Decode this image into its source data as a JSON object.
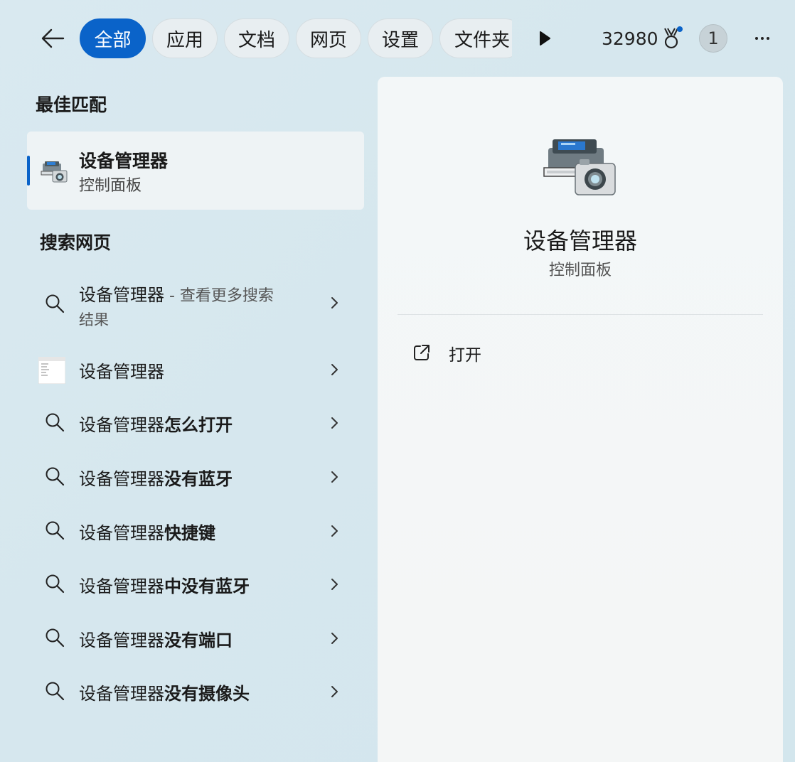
{
  "topbar": {
    "tabs": [
      {
        "label": "全部",
        "active": true
      },
      {
        "label": "应用",
        "active": false
      },
      {
        "label": "文档",
        "active": false
      },
      {
        "label": "网页",
        "active": false
      },
      {
        "label": "设置",
        "active": false
      },
      {
        "label": "文件夹",
        "active": false
      }
    ],
    "points": "32980",
    "user_badge": "1"
  },
  "best_match": {
    "section_title": "最佳匹配",
    "title": "设备管理器",
    "subtitle": "控制面板"
  },
  "web_search": {
    "section_title": "搜索网页",
    "items": [
      {
        "prefix": "设备管理器",
        "bold": "",
        "suffix": " - 查看更多搜索",
        "line2": "结果",
        "icon": "search-icon"
      },
      {
        "prefix": "设备管理器",
        "bold": "",
        "suffix": "",
        "line2": "",
        "icon": "web-thumbnail"
      },
      {
        "prefix": "设备管理器",
        "bold": "怎么打开",
        "suffix": "",
        "line2": "",
        "icon": "search-icon"
      },
      {
        "prefix": "设备管理器",
        "bold": "没有蓝牙",
        "suffix": "",
        "line2": "",
        "icon": "search-icon"
      },
      {
        "prefix": "设备管理器",
        "bold": "快捷键",
        "suffix": "",
        "line2": "",
        "icon": "search-icon"
      },
      {
        "prefix": "设备管理器",
        "bold": "中没有蓝牙",
        "suffix": "",
        "line2": "",
        "icon": "search-icon"
      },
      {
        "prefix": "设备管理器",
        "bold": "没有端口",
        "suffix": "",
        "line2": "",
        "icon": "search-icon"
      },
      {
        "prefix": "设备管理器",
        "bold": "没有摄像头",
        "suffix": "",
        "line2": "",
        "icon": "search-icon"
      }
    ]
  },
  "detail": {
    "title": "设备管理器",
    "subtitle": "控制面板",
    "actions": [
      {
        "label": "打开",
        "icon": "open-external-icon"
      }
    ]
  },
  "colors": {
    "accent": "#0a63c9",
    "background": "#d6e7ee"
  }
}
